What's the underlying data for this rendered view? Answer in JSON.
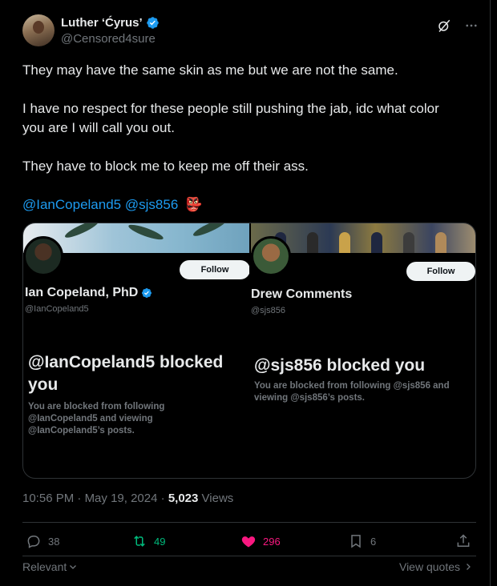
{
  "author": {
    "display_name": "Luther ‘Ćyrus’",
    "handle": "@Censored4sure"
  },
  "tweet": {
    "paragraphs": [
      "They may have the same skin as me but we are not the same.",
      "I have no respect for these people still pushing the jab, idc what color",
      "you are I will call you out.",
      "They have to block me to keep me off their ass."
    ],
    "mentions": [
      "@IanCopeland5",
      "@sjs856"
    ],
    "emoji": "👺"
  },
  "media": {
    "left_card": {
      "follow_label": "Follow",
      "name": "Ian Copeland, PhD",
      "handle": "@IanCopeland5",
      "blocked_title": "@IanCopeland5 blocked you",
      "blocked_desc": "You are blocked from following @IanCopeland5 and viewing @IanCopeland5’s posts."
    },
    "right_card": {
      "follow_label": "Follow",
      "name": "Drew Comments",
      "handle": "@sjs856",
      "blocked_title": "@sjs856 blocked you",
      "blocked_desc": "You are blocked from following @sjs856 and viewing @sjs856’s posts."
    }
  },
  "meta": {
    "time": "10:56 PM",
    "separator": "·",
    "date": "May 19, 2024",
    "views_count": "5,023",
    "views_label": "Views"
  },
  "actions": {
    "replies": "38",
    "reposts": "49",
    "likes": "296",
    "bookmarks": "6"
  },
  "footer": {
    "relevant_label": "Relevant",
    "view_quotes_label": "View quotes"
  },
  "colors": {
    "background": "#000000",
    "text_primary": "#e7e9ea",
    "text_secondary": "#71767b",
    "link_blue": "#1d9bf0",
    "repost_green": "#00ba7c",
    "like_pink": "#f91880",
    "border": "#2f3336"
  }
}
